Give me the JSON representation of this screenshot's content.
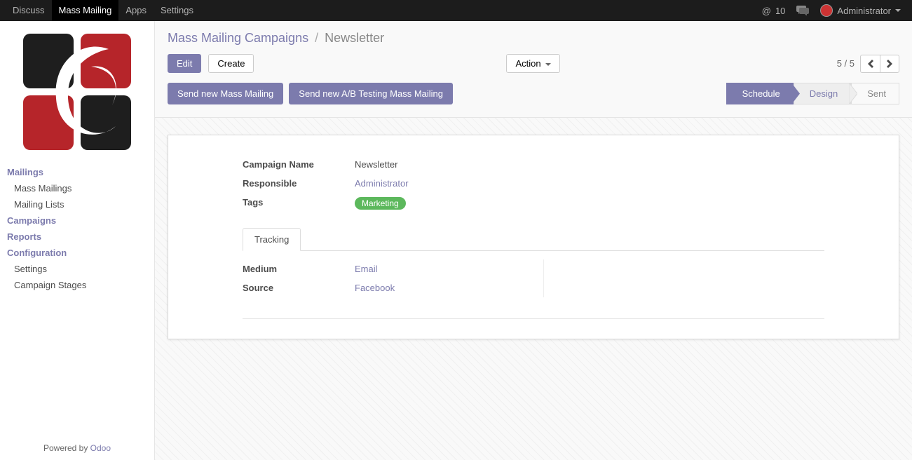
{
  "topnav": {
    "items": [
      "Discuss",
      "Mass Mailing",
      "Apps",
      "Settings"
    ],
    "active_index": 1,
    "messages_count": "10",
    "at_symbol": "@",
    "user_label": "Administrator"
  },
  "sidebar": {
    "sections": {
      "mailings": {
        "label": "Mailings",
        "items": [
          "Mass Mailings",
          "Mailing Lists"
        ]
      },
      "campaigns": {
        "label": "Campaigns"
      },
      "reports": {
        "label": "Reports"
      },
      "configuration": {
        "label": "Configuration",
        "items": [
          "Settings",
          "Campaign Stages"
        ]
      }
    },
    "powered_prefix": "Powered by ",
    "powered_link": "Odoo"
  },
  "breadcrumb": {
    "parent": "Mass Mailing Campaigns",
    "current": "Newsletter"
  },
  "toolbar": {
    "edit": "Edit",
    "create": "Create",
    "action": "Action",
    "pager": "5 / 5"
  },
  "buttons": {
    "send_mass": "Send new Mass Mailing",
    "send_ab": "Send new A/B Testing Mass Mailing"
  },
  "stages": {
    "schedule": "Schedule",
    "design": "Design",
    "sent": "Sent",
    "active_index": 0
  },
  "form": {
    "campaign_name_label": "Campaign Name",
    "campaign_name": "Newsletter",
    "responsible_label": "Responsible",
    "responsible": "Administrator",
    "tags_label": "Tags",
    "tag0": "Marketing",
    "tracking_tab": "Tracking",
    "medium_label": "Medium",
    "medium": "Email",
    "source_label": "Source",
    "source": "Facebook"
  }
}
